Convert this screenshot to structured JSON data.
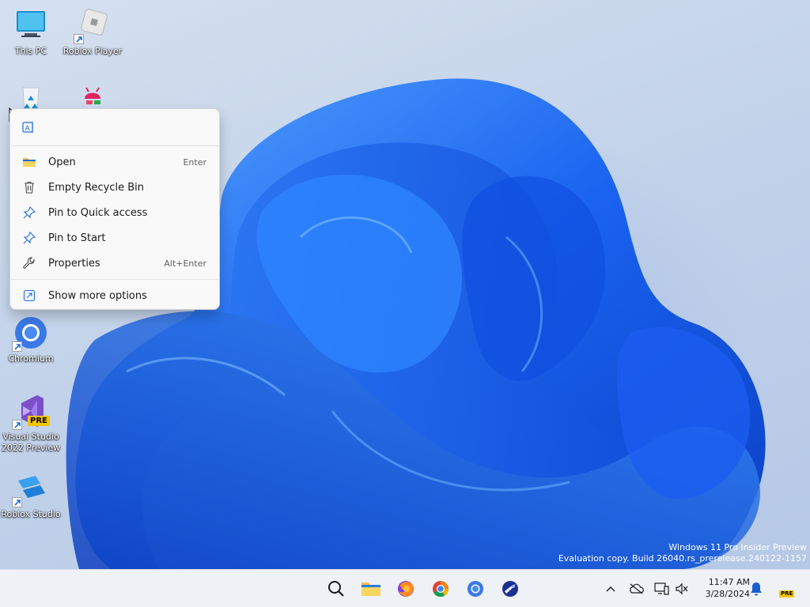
{
  "desktop": {
    "icons": [
      {
        "label": "This PC"
      },
      {
        "label": "Roblox Player"
      },
      {
        "label": ""
      },
      {
        "label": ""
      },
      {
        "label": "Chromium"
      },
      {
        "label": "Visual Studio 2022 Preview"
      },
      {
        "label": "Roblox Studio"
      }
    ],
    "vs_badge": "PRE"
  },
  "context_menu": {
    "items": [
      {
        "label": "Open",
        "shortcut": "Enter",
        "icon": "folder-icon"
      },
      {
        "label": "Empty Recycle Bin",
        "shortcut": "",
        "icon": "trash-icon"
      },
      {
        "label": "Pin to Quick access",
        "shortcut": "",
        "icon": "pin-icon"
      },
      {
        "label": "Pin to Start",
        "shortcut": "",
        "icon": "pin-icon"
      },
      {
        "label": "Properties",
        "shortcut": "Alt+Enter",
        "icon": "wrench-icon"
      }
    ],
    "more_options": "Show more options",
    "top_icon": "rename-icon"
  },
  "watermark": {
    "line1": "Windows 11 Pro Insider Preview",
    "line2": "Evaluation copy. Build 26040.rs_prerelease.240122-1157"
  },
  "taskbar": {
    "apps": [
      "search-icon",
      "file-explorer-icon",
      "firefox-icon",
      "chrome-icon",
      "chromium-icon",
      "app-icon"
    ],
    "tray": [
      "chevron-up-icon",
      "onedrive-icon",
      "network-icon",
      "volume-muted-icon"
    ],
    "time": "11:47 AM",
    "date": "3/28/2024",
    "badge": "PRE"
  },
  "colors": {
    "accent": "#0067c0",
    "wallpaper_blue": "#1a63f0"
  }
}
